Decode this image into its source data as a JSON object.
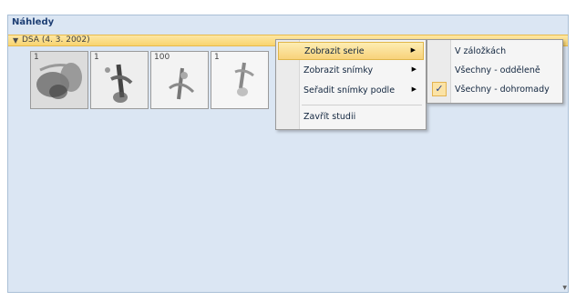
{
  "panel": {
    "title": "Náhledy",
    "group": {
      "arrow_icon": "triangle-down-icon",
      "label": "DSA (4. 3. 2002)"
    },
    "thumbnails": [
      {
        "number": "1"
      },
      {
        "number": "1"
      },
      {
        "number": "100"
      },
      {
        "number": "1"
      }
    ]
  },
  "context_menu": {
    "items": [
      {
        "label": "Zobrazit serie",
        "highlighted": true,
        "has_submenu": true
      },
      {
        "label": "Zobrazit snímky",
        "has_submenu": true
      },
      {
        "label": "Seřadit snímky podle",
        "has_submenu": true
      },
      {
        "label": "Zavřít studii"
      }
    ]
  },
  "submenu": {
    "items": [
      {
        "label": "V záložkách"
      },
      {
        "label": "Všechny - odděleně"
      },
      {
        "label": "Všechny - dohromady",
        "checked": true
      }
    ]
  },
  "colors": {
    "panel_bg": "#dbe6f3",
    "group_header": "#f8d470",
    "title_text": "#1e3f74"
  }
}
